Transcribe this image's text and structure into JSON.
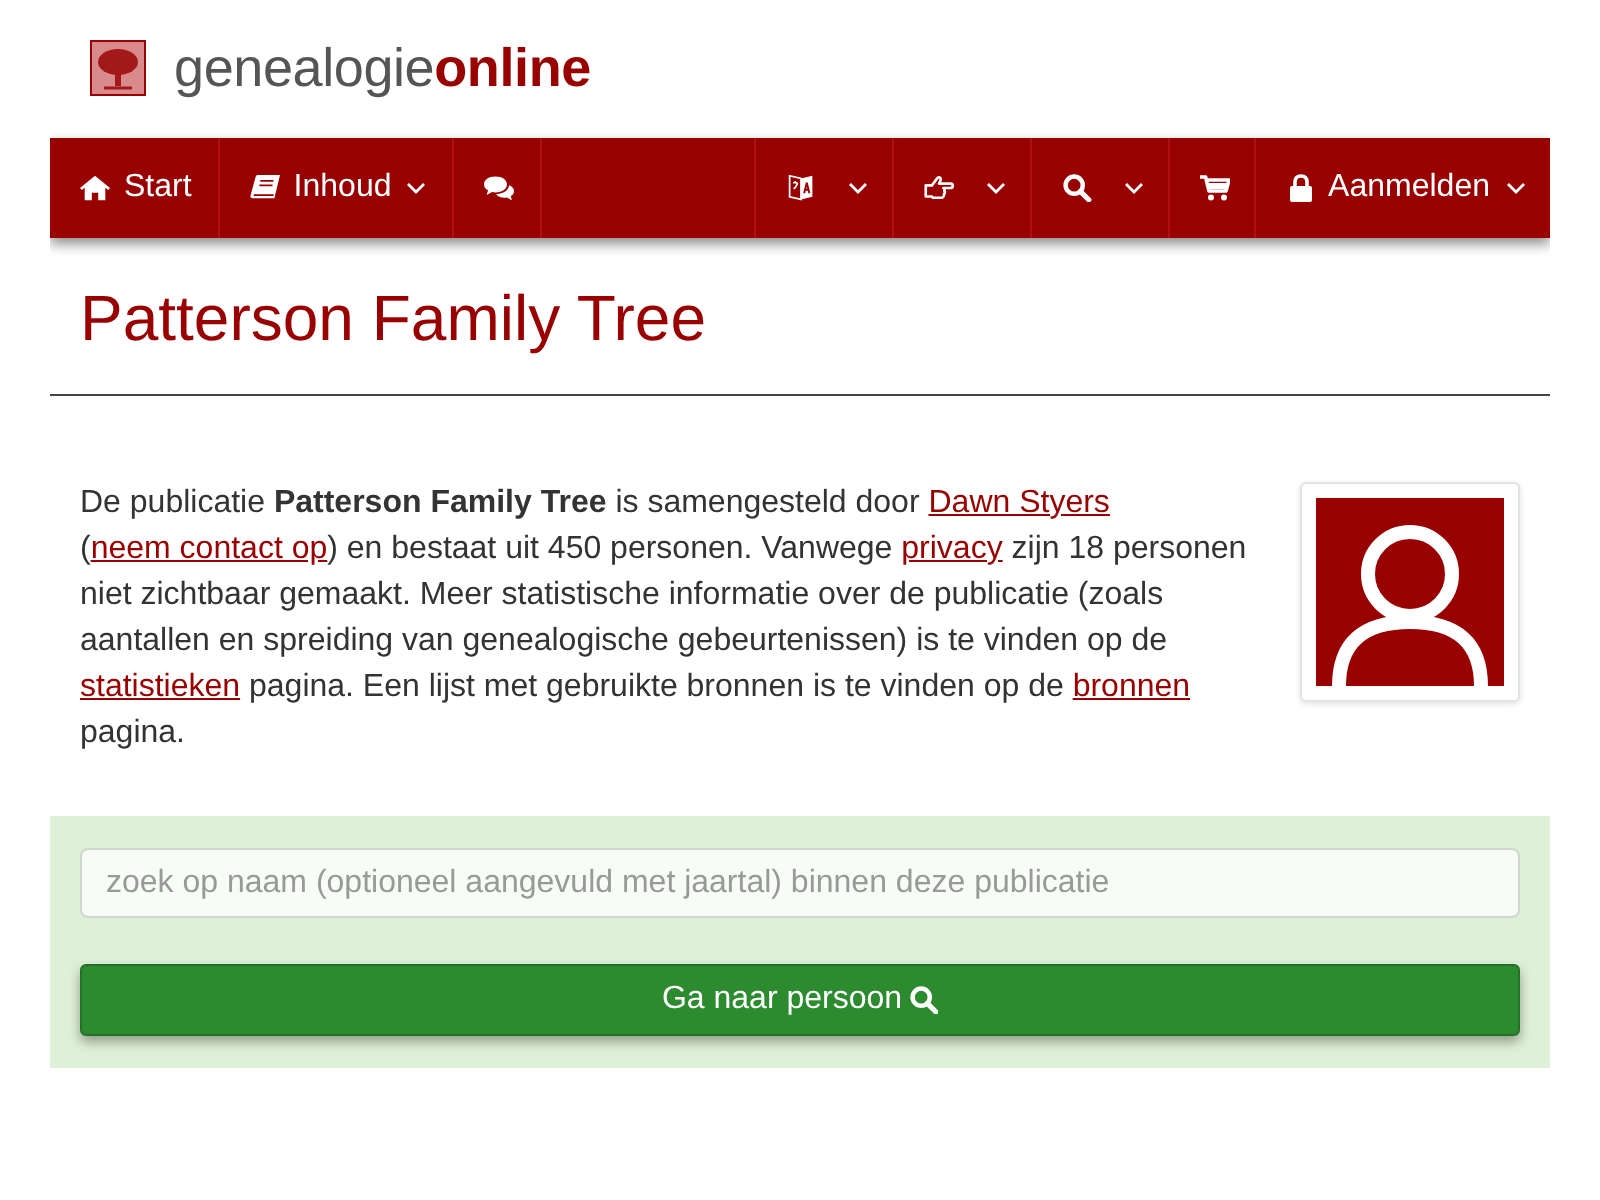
{
  "logo": {
    "text": "genealogie**online**"
  },
  "nav": {
    "left": [
      {
        "label": "Start",
        "dropdown": false
      },
      {
        "label": "Inhoud",
        "dropdown": true
      },
      {
        "dropdown": false
      }
    ],
    "right": [
      {
        "dropdown": true
      },
      {
        "dropdown": true
      },
      {
        "dropdown": true
      },
      {
        "dropdown": false
      },
      {
        "label": "Aanmelden",
        "dropdown": true
      }
    ]
  },
  "title": "Patterson Family Tree",
  "intro": [
    {
      "kind": "text",
      "text": "De publicatie **Patterson Family Tree** is samengesteld door "
    },
    {
      "kind": "link",
      "text": "Dawn Styers"
    },
    {
      "kind": "text",
      "text": " ("
    },
    {
      "kind": "link",
      "text": "neem contact op"
    },
    {
      "kind": "text",
      "text": ") en bestaat uit 450 personen. Vanwege "
    },
    {
      "kind": "link",
      "text": "privacy"
    },
    {
      "kind": "text",
      "text": " zijn 18 personen niet zichtbaar gemaakt. Meer statistische informatie over de publicatie (zoals aantallen en spreiding van genealogische gebeurtenissen) is te vinden op de "
    },
    {
      "kind": "link",
      "text": "statistieken"
    },
    {
      "kind": "text",
      "text": " pagina. Een lijst met gebruikte bronnen is te vinden op de "
    },
    {
      "kind": "link",
      "text": "bronnen"
    },
    {
      "kind": "text",
      "text": " pagina."
    }
  ],
  "search": {
    "placeholder": "zoek op naam (optioneel aangevuld met jaartal) binnen deze publicatie",
    "button": "Ga naar persoon"
  }
}
